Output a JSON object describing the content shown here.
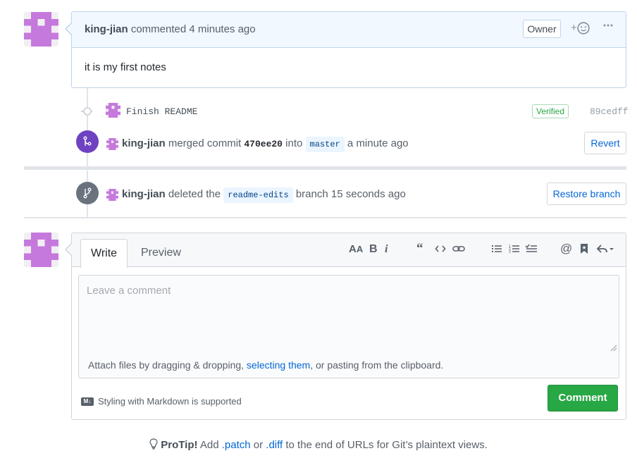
{
  "comment": {
    "author": "king-jian",
    "action": "commented",
    "time": "4 minutes ago",
    "role_badge": "Owner",
    "reaction_icon": "smiley-icon",
    "more_icon": "kebab-horizontal-icon",
    "body": "it is my first notes"
  },
  "commit": {
    "message": "Finish README",
    "verified_label": "Verified",
    "sha": "89cedff"
  },
  "merge_event": {
    "author": "king-jian",
    "action": "merged commit",
    "commit_sha": "470ee20",
    "into": "into",
    "branch": "master",
    "time": "a minute ago",
    "button_label": "Revert"
  },
  "delete_event": {
    "author": "king-jian",
    "action": "deleted the",
    "branch": "readme-edits",
    "suffix": "branch 15 seconds ago",
    "button_label": "Restore branch"
  },
  "new_comment": {
    "tabs": [
      "Write",
      "Preview"
    ],
    "placeholder": "Leave a comment",
    "attach_prefix": "Attach files by dragging & dropping, ",
    "attach_link": "selecting them",
    "attach_suffix": ", or pasting from the clipboard.",
    "markdown_note": "Styling with Markdown is supported",
    "markdown_icon_label": "M↓",
    "submit_label": "Comment",
    "toolbar": [
      "header-icon",
      "bold-icon",
      "italic-icon",
      "quote-icon",
      "code-icon",
      "link-icon",
      "unordered-list-icon",
      "ordered-list-icon",
      "task-list-icon",
      "mention-icon",
      "bookmark-icon",
      "reply-icon"
    ]
  },
  "protip": {
    "label": "ProTip!",
    "text_1": " Add ",
    "patch": ".patch",
    "text_2": " or ",
    "diff": ".diff",
    "text_3": " to the end of URLs for Git’s plaintext views."
  },
  "colors": {
    "merged_purple": "#6f42c1",
    "deleted_gray": "#6a737d",
    "green": "#28a745",
    "link_blue": "#0366d6",
    "identicon": "#c679dc"
  }
}
